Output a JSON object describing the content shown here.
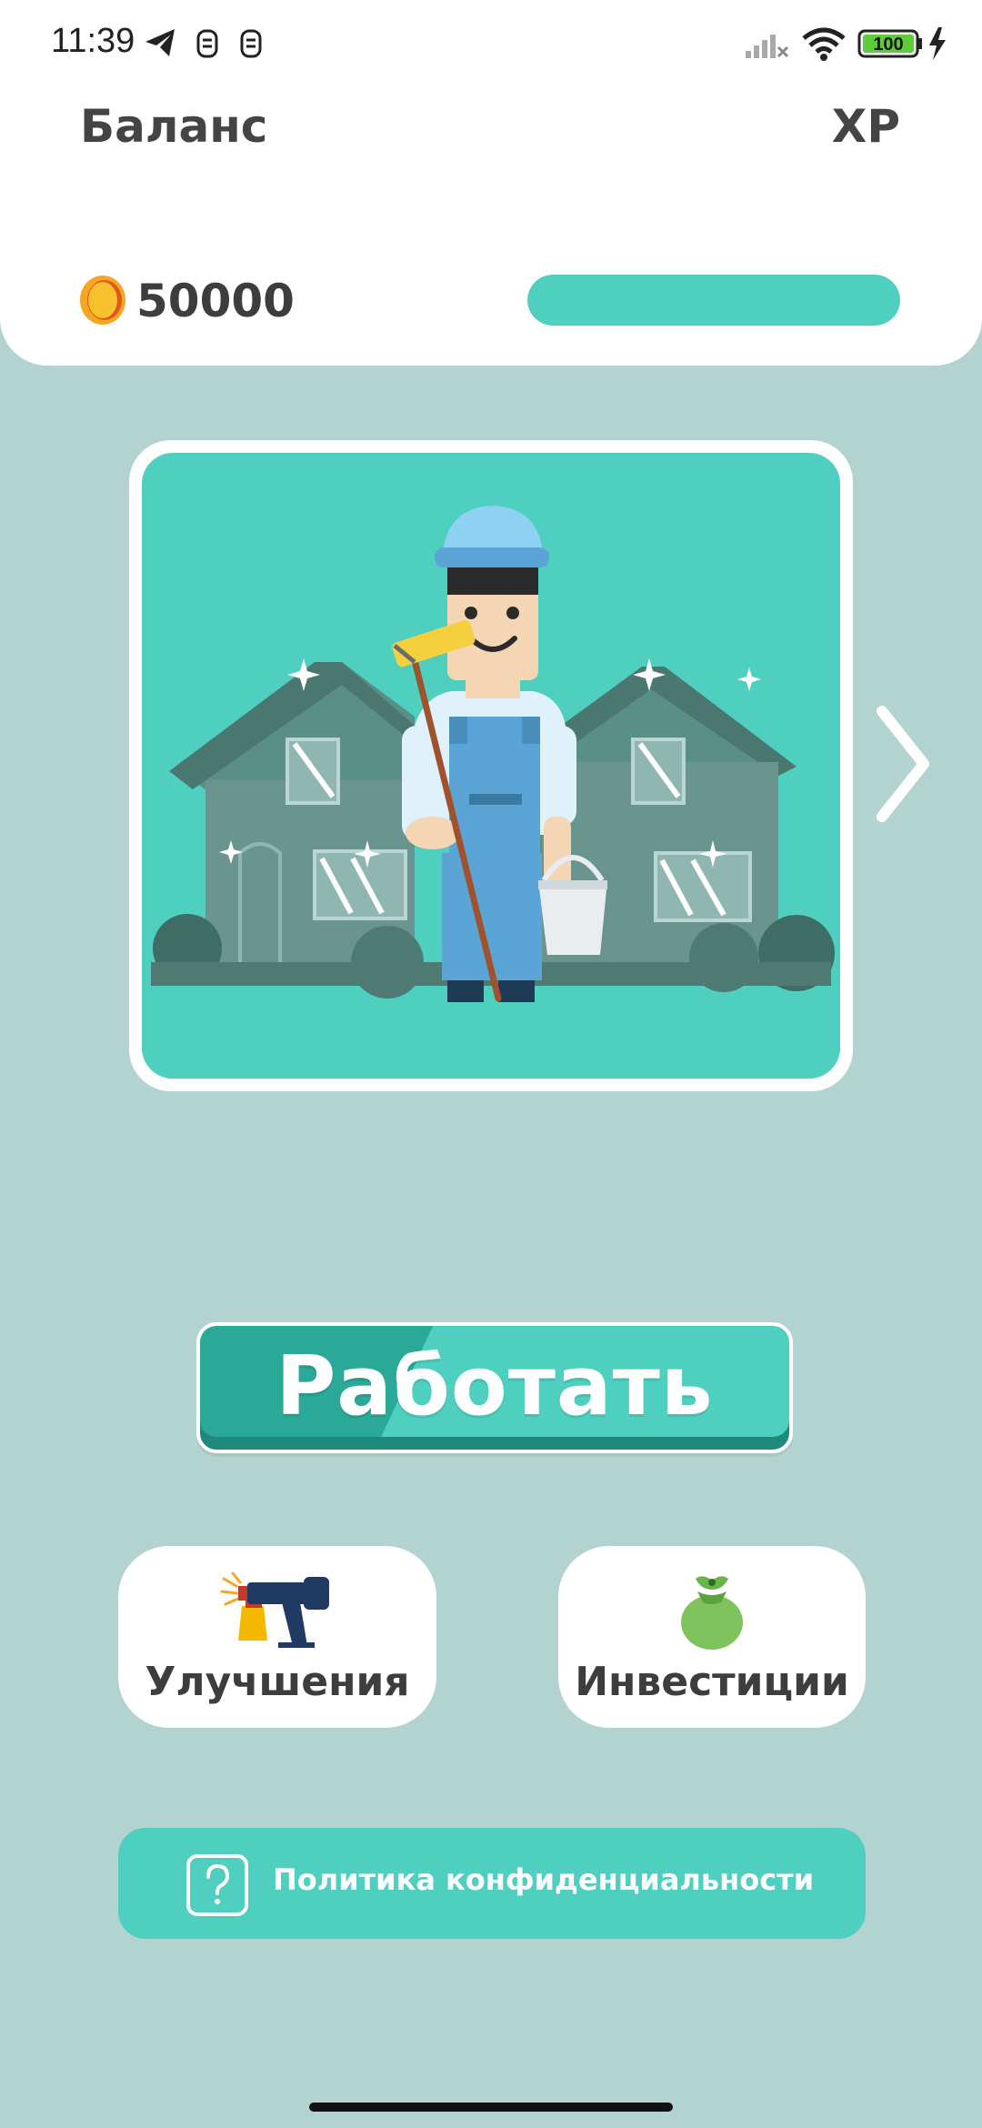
{
  "status_bar": {
    "time": "11:39",
    "battery": "100",
    "icons": [
      "telegram-icon",
      "notification-icon",
      "notification-icon",
      "signal-icon",
      "wifi-icon",
      "battery-icon",
      "charging-icon"
    ]
  },
  "header": {
    "balance_label": "Баланс",
    "balance_value": "50000",
    "xp_label": "XP",
    "xp_progress": 1.0
  },
  "job": {
    "illustration": "painter-with-houses",
    "next_icon": "chevron-right-icon"
  },
  "actions": {
    "work_label": "Работать",
    "upgrades_label": "Улучшения",
    "upgrades_icon": "spray-gun-icon",
    "investments_label": "Инвестиции",
    "investments_icon": "money-bag-icon"
  },
  "footer": {
    "privacy_label": "Политика конфиденциальности",
    "privacy_icon": "question-icon"
  },
  "colors": {
    "background": "#b3d3d0",
    "accent": "#4ecfbf",
    "accent_dark": "#2aa898",
    "text": "#3d3d3d"
  }
}
